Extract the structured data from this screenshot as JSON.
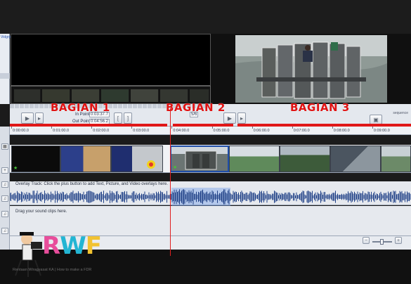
{
  "left_panel": {
    "label": "Vidgrph"
  },
  "controls": {
    "in_point_label": "In Point",
    "in_point_value": "0:03:37.7",
    "out_point_label": "Out Point",
    "out_point_value": "0:04:56.2",
    "center_value": "5/6",
    "sequence_label": "sequence"
  },
  "overlay_labels": {
    "part1": "BAGIAN 1",
    "part2": "BAGIAN 2",
    "part3": "BAGIAN 3",
    "accent_color": "#e01212"
  },
  "timeline": {
    "ticks": [
      "0:00:00.0",
      "0:01:00.0",
      "0:02:00.0",
      "0:03:00.0",
      "0:04:00.0",
      "0:05:00.0",
      "0:06:00.0",
      "0:07:00.0",
      "0:08:00.0",
      "0:09:00.0"
    ]
  },
  "tracks": {
    "overlay_hint": "Overlay Track: Click the plus button to add Text, Picture, and Video overlays here.",
    "sound_hint": "Drag your sound clips here."
  },
  "icons": {
    "play": "play-icon",
    "camera": "camera-icon",
    "speaker": "speaker-icon",
    "zoom_in": "zoom-in-icon",
    "zoom_out": "zoom-out-icon"
  },
  "logo": {
    "text": "RWF",
    "tagline": "Rentaan Wiragyasat KA | How to make a FDR"
  }
}
